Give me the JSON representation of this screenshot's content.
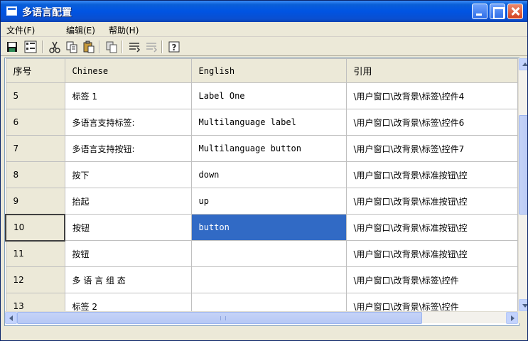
{
  "window": {
    "title": "多语言配置"
  },
  "menu": {
    "file": "文件(F)",
    "edit": "编辑(E)",
    "help": "帮助(H)"
  },
  "toolbar": {
    "icons": [
      "save-icon",
      "translate-icon",
      "cut-icon",
      "copy-icon",
      "paste-icon",
      "paste-special-icon",
      "align-left-icon",
      "align-right-icon",
      "help-icon"
    ]
  },
  "table": {
    "headers": {
      "num": "序号",
      "chinese": "Chinese",
      "english": "English",
      "ref": "引用"
    },
    "rows": [
      {
        "num": "5",
        "chinese": "标签 1",
        "english": "Label One",
        "ref": "\\用户窗口\\改背景\\标签\\控件4"
      },
      {
        "num": "6",
        "chinese": "多语言支持标签:",
        "english": "Multilanguage label",
        "ref": "\\用户窗口\\改背景\\标签\\控件6"
      },
      {
        "num": "7",
        "chinese": "多语言支持按钮:",
        "english": "Multilanguage button",
        "ref": "\\用户窗口\\改背景\\标签\\控件7"
      },
      {
        "num": "8",
        "chinese": "按下",
        "english": "down",
        "ref": "\\用户窗口\\改背景\\标准按钮\\控"
      },
      {
        "num": "9",
        "chinese": "抬起",
        "english": "up",
        "ref": "\\用户窗口\\改背景\\标准按钮\\控"
      },
      {
        "num": "10",
        "chinese": "按钮",
        "english": "button",
        "ref": "\\用户窗口\\改背景\\标准按钮\\控"
      },
      {
        "num": "11",
        "chinese": "按钮",
        "english": "",
        "ref": "\\用户窗口\\改背景\\标准按钮\\控"
      },
      {
        "num": "12",
        "chinese": "多 语 言 组 态",
        "english": "",
        "ref": "\\用户窗口\\改背景\\标签\\控件"
      },
      {
        "num": "13",
        "chinese": "标签 2",
        "english": "",
        "ref": "\\用户窗口\\改背景\\标签\\控件"
      }
    ]
  },
  "colors": {
    "selection": "#316ac5",
    "titlebar": "#0054e3",
    "header": "#ece9d8"
  }
}
